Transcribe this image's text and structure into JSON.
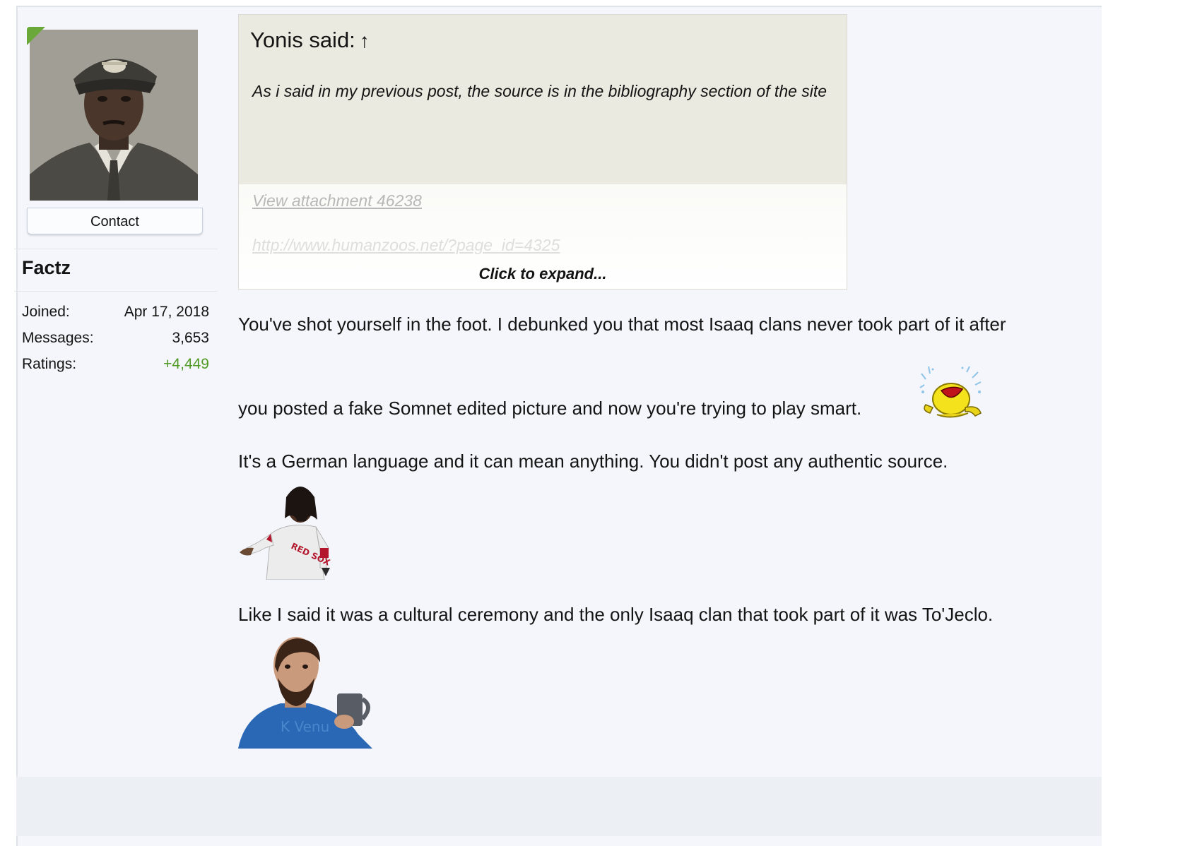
{
  "user": {
    "avatar_icon": "user-avatar-photo",
    "online_color": "#6aa83a",
    "contact_label": "Contact",
    "username": "Factz",
    "stats": [
      {
        "label": "Joined:",
        "value": "Apr 17, 2018"
      },
      {
        "label": "Messages:",
        "value": "3,653"
      },
      {
        "label": "Ratings:",
        "value": "+4,449"
      }
    ]
  },
  "quote": {
    "author": "Yonis said:",
    "arrow": "↑",
    "text": "As i said in my previous post, the source is in the bibliography section of the site",
    "attachment_link": "View attachment 46238",
    "url_link": "http://www.humanzoos.net/?page_id=4325",
    "expand_label": "Click to expand..."
  },
  "message": {
    "line1": "You've shot yourself in the foot. I debunked you that most Isaaq clans never took part of it after",
    "line2": "you posted a fake Somnet edited picture and now you're trying to play smart.",
    "line3": "It's a German language and it can mean anything. You didn't post any authentic source.",
    "line4": "Like I said it was a cultural ceremony and the only Isaaq clan that took part of it was To'Jeclo.",
    "smiley_icon": "laughing-smiley-icon",
    "sticker1_icon": "shrugging-baseball-player-sticker",
    "sticker2_icon": "man-holding-mug-sticker"
  },
  "colors": {
    "positive": "#4f9a24",
    "quote_bg": "#ebeae0",
    "post_bg": "#f4f6fb"
  }
}
